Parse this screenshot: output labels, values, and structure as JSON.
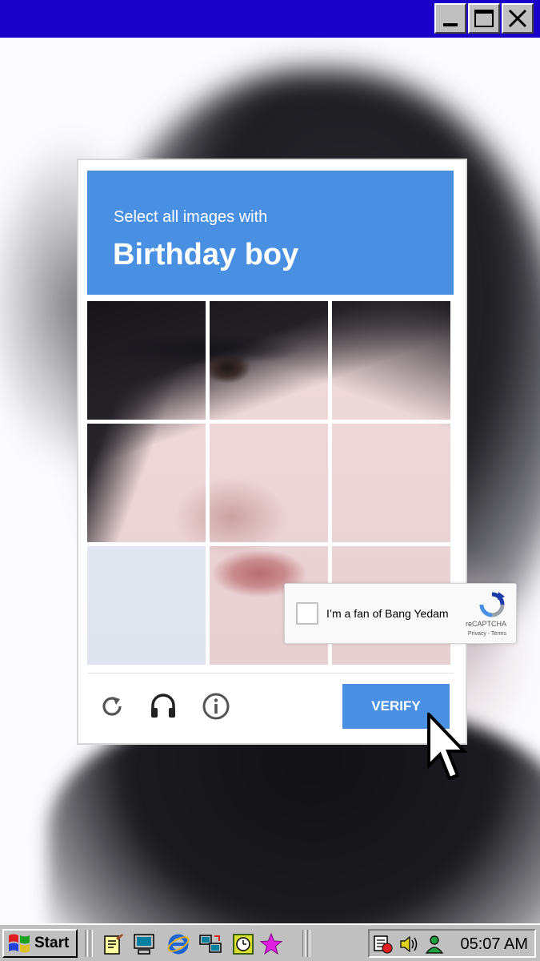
{
  "captcha": {
    "instruction": "Select all images with",
    "target": "Birthday boy",
    "verify_label": "VERIFY",
    "tool_icons": [
      "reload-icon",
      "headphones-icon",
      "info-icon"
    ],
    "accent_color": "#4a90e2"
  },
  "recaptcha": {
    "checkbox_label": "I’m a fan of Bang Yedam",
    "brand": "reCAPTCHA",
    "links": "Privacy - Terms",
    "checked": false
  },
  "window": {
    "title_bar_color": "#1a00c8",
    "controls": [
      "minimize-icon",
      "maximize-icon",
      "close-icon"
    ]
  },
  "taskbar": {
    "start_label": "Start",
    "quick_launch": [
      "notepad-icon",
      "my-computer-icon",
      "internet-explorer-icon",
      "network-icon",
      "clock-app-icon",
      "star-icon"
    ],
    "tray_icons": [
      "scheduler-icon",
      "volume-icon",
      "users-icon"
    ],
    "clock": "05:07 AM"
  }
}
